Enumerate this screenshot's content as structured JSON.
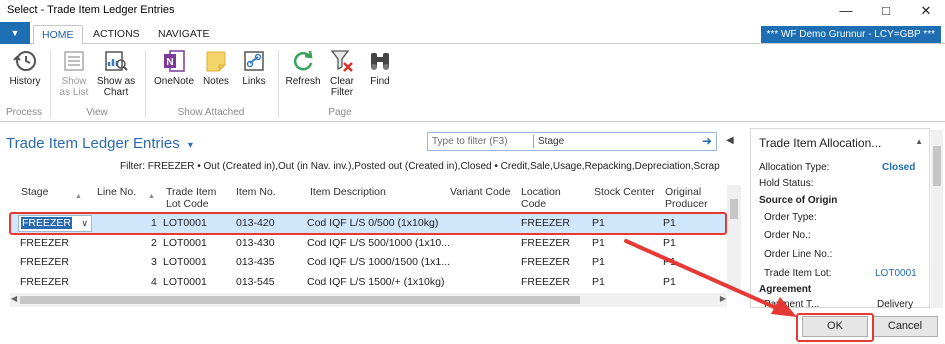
{
  "window": {
    "title": "Select - Trade Item Ledger Entries",
    "min_icon": "minimize-icon",
    "max_icon": "maximize-icon",
    "close_icon": "close-icon"
  },
  "tabs": [
    {
      "label": "HOME"
    },
    {
      "label": "ACTIONS"
    },
    {
      "label": "NAVIGATE"
    }
  ],
  "company_label": "*** WF Demo Grunnur - LCY=GBP ***",
  "ribbon": {
    "history": "History",
    "show_as_list": "Show as List",
    "show_as_chart": "Show as Chart",
    "onenote": "OneNote",
    "notes": "Notes",
    "links": "Links",
    "refresh": "Refresh",
    "clear_filter": "Clear Filter",
    "find": "Find",
    "groups": {
      "process": "Process",
      "view": "View",
      "show_attached": "Show Attached",
      "page": "Page"
    }
  },
  "page": {
    "title": "Trade Item Ledger Entries",
    "title_dropdown_icon": "chevron-down-icon",
    "filter_placeholder": "Type to filter (F3)",
    "filter_field": "Stage",
    "filter_text": "Filter: FREEZER • Out (Created in),Out (in Nav. inv.),Posted out (Created in),Closed • Credit,Sale,Usage,Repacking,Depreciation,Scrap"
  },
  "grid": {
    "columns": {
      "stage": "Stage",
      "line_no": "Line No.",
      "lot_code": "Trade Item Lot Code",
      "item_no": "Item No.",
      "item_desc": "Item Description",
      "variant": "Variant Code",
      "location": "Location Code",
      "stock_center": "Stock Center",
      "producer": "Original Producer"
    },
    "rows": [
      {
        "stage": "FREEZER",
        "line_no": "1",
        "lot": "LOT0001",
        "item_no": "013-420",
        "desc": "Cod IQF L/S 0/500 (1x10kg)",
        "location": "FREEZER",
        "center": "P1",
        "producer": "P1"
      },
      {
        "stage": "FREEZER",
        "line_no": "2",
        "lot": "LOT0001",
        "item_no": "013-430",
        "desc": "Cod IQF L/S 500/1000 (1x10...",
        "location": "FREEZER",
        "center": "P1",
        "producer": "P1"
      },
      {
        "stage": "FREEZER",
        "line_no": "3",
        "lot": "LOT0001",
        "item_no": "013-435",
        "desc": "Cod IQF L/S 1000/1500 (1x1...",
        "location": "FREEZER",
        "center": "P1",
        "producer": "P1"
      },
      {
        "stage": "FREEZER",
        "line_no": "4",
        "lot": "LOT0001",
        "item_no": "013-545",
        "desc": "Cod IQF L/S 1500/+ (1x10kg)",
        "location": "FREEZER",
        "center": "P1",
        "producer": "P1"
      }
    ]
  },
  "factbox": {
    "title": "Trade Item Allocation...",
    "allocation_type_label": "Allocation Type:",
    "allocation_type_value": "Closed",
    "hold_status_label": "Hold Status:",
    "source_of_origin": "Source of Origin",
    "order_type_label": "Order Type:",
    "order_no_label": "Order No.:",
    "order_line_no_label": "Order Line No.:",
    "trade_item_lot_label": "Trade Item Lot:",
    "trade_item_lot_value": "LOT0001",
    "agreement": "Agreement",
    "payment_label": "Payment T...",
    "payment_value": "Delivery"
  },
  "footer": {
    "ok": "OK",
    "cancel": "Cancel"
  },
  "colors": {
    "accent": "#1e6eb4",
    "selection": "#cfe6fb",
    "highlight_box": "#e53935"
  }
}
